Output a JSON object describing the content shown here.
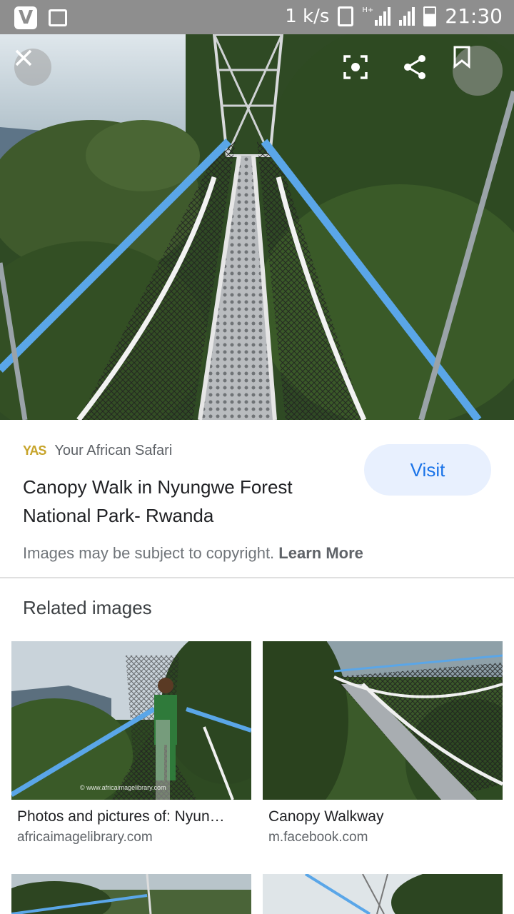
{
  "status_bar": {
    "net_speed": "1 k/s",
    "network_type": "H+",
    "time": "21:30",
    "icons": [
      "vlc-icon",
      "gallery-icon",
      "vibrate-icon",
      "signal-icon",
      "battery-icon"
    ]
  },
  "viewer": {
    "close_icon": "close-icon",
    "lens_icon": "lens-icon",
    "share_icon": "share-icon",
    "save_icon": "bookmark-icon"
  },
  "result": {
    "source_logo": "YAS",
    "source_name": "Your African Safari",
    "title": "Canopy Walk in Nyungwe Forest National Park- Rwanda",
    "visit_label": "Visit",
    "copyright_text": "Images may be subject to copyright.",
    "learn_more": "Learn More"
  },
  "related": {
    "heading": "Related images",
    "items": [
      {
        "title": "Photos and pictures of: Nyun…",
        "source": "africaimagelibrary.com",
        "watermark": "© www.africaimagelibrary.com"
      },
      {
        "title": "Canopy Walkway",
        "source": "m.facebook.com"
      }
    ]
  },
  "colors": {
    "accent": "#1a73e8",
    "visit_bg": "#e8f0fe",
    "status_bar": "#8e8e8e",
    "rope_blue": "#5aa6e8"
  }
}
